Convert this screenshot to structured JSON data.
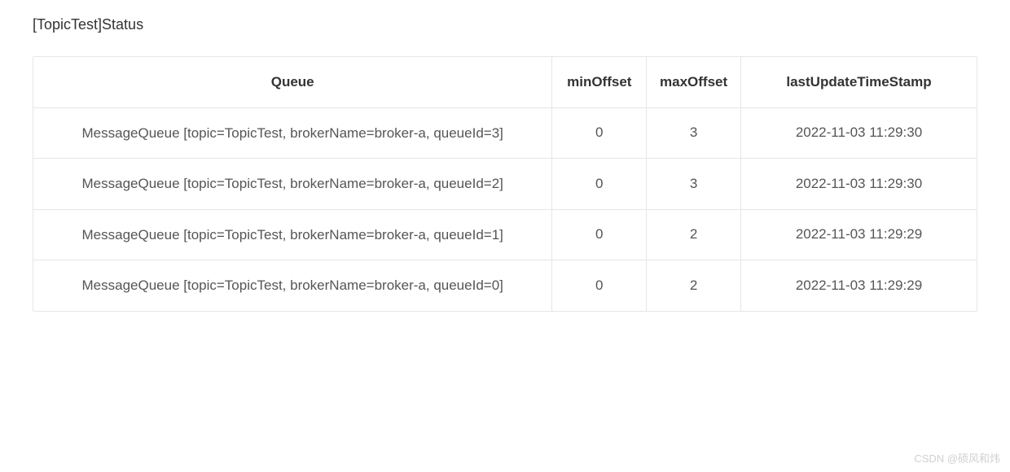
{
  "title": "[TopicTest]Status",
  "columns": {
    "queue": "Queue",
    "minOffset": "minOffset",
    "maxOffset": "maxOffset",
    "lastUpdateTimeStamp": "lastUpdateTimeStamp"
  },
  "rows": [
    {
      "queue": "MessageQueue [topic=TopicTest, brokerName=broker-a, queueId=3]",
      "minOffset": "0",
      "maxOffset": "3",
      "lastUpdateTimeStamp": "2022-11-03 11:29:30"
    },
    {
      "queue": "MessageQueue [topic=TopicTest, brokerName=broker-a, queueId=2]",
      "minOffset": "0",
      "maxOffset": "3",
      "lastUpdateTimeStamp": "2022-11-03 11:29:30"
    },
    {
      "queue": "MessageQueue [topic=TopicTest, brokerName=broker-a, queueId=1]",
      "minOffset": "0",
      "maxOffset": "2",
      "lastUpdateTimeStamp": "2022-11-03 11:29:29"
    },
    {
      "queue": "MessageQueue [topic=TopicTest, brokerName=broker-a, queueId=0]",
      "minOffset": "0",
      "maxOffset": "2",
      "lastUpdateTimeStamp": "2022-11-03 11:29:29"
    }
  ],
  "watermark": "CSDN @硕风和炜"
}
